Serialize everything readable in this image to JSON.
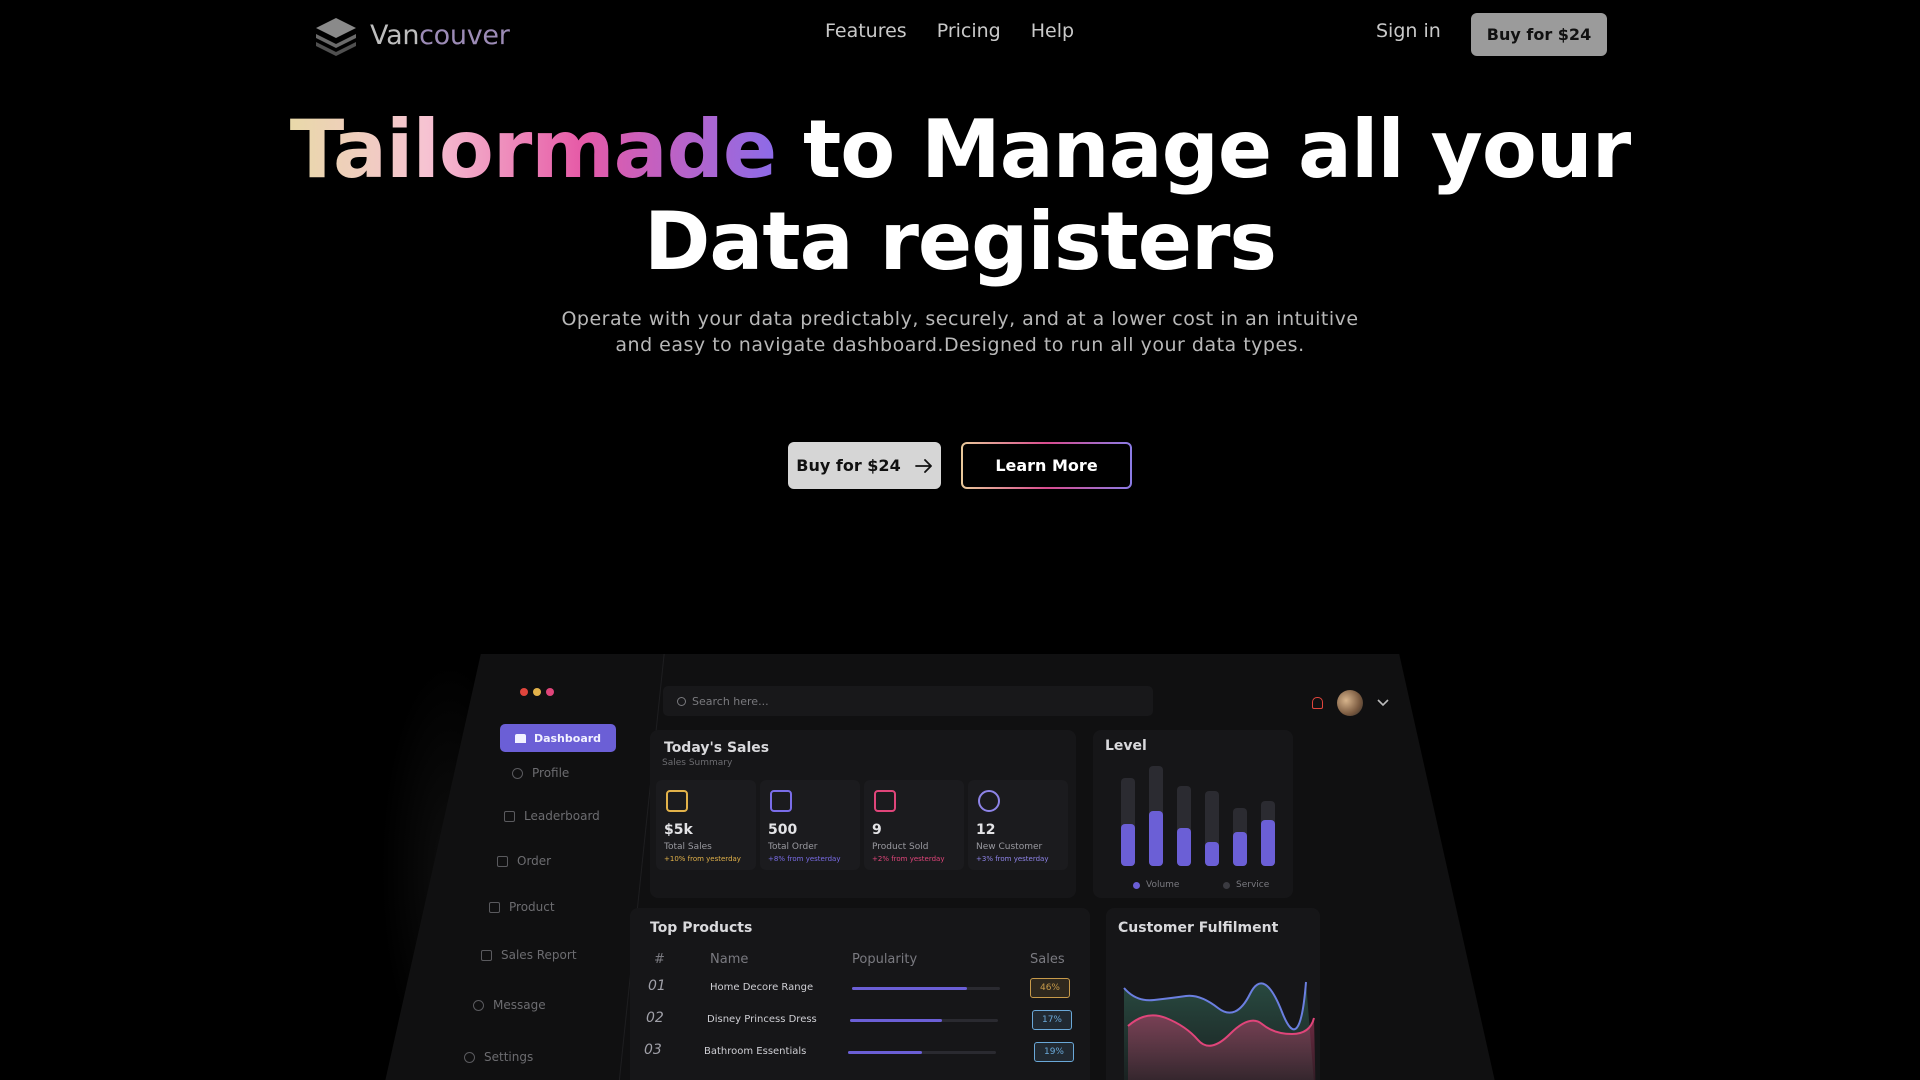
{
  "nav": {
    "logo_part1": "Van",
    "logo_part2": "couver",
    "links": [
      "Features",
      "Pricing",
      "Help"
    ],
    "signin": "Sign in",
    "buy": "Buy for $24"
  },
  "hero": {
    "title_highlight": "Tailormade",
    "title_rest_line1": " to Manage all your",
    "title_line2": "Data registers",
    "subtitle_line1": "Operate with your data predictably, securely, and at a lower cost in an intuitive",
    "subtitle_line2": "and easy to navigate dashboard.Designed to run all your data types.",
    "buy_label": "Buy for $24",
    "learn_label": "Learn More"
  },
  "dashboard": {
    "sidebar": [
      "Dashboard",
      "Profile",
      "Leaderboard",
      "Order",
      "Product",
      "Sales Report",
      "Message",
      "Settings"
    ],
    "search_placeholder": "Search here...",
    "sales": {
      "title": "Today's Sales",
      "subtitle": "Sales Summary",
      "stats": [
        {
          "value": "$5k",
          "label": "Total Sales",
          "change": "+10% from yesterday",
          "color": "#e2b24a"
        },
        {
          "value": "500",
          "label": "Total Order",
          "change": "+8% from yesterday",
          "color": "#7a6de8"
        },
        {
          "value": "9",
          "label": "Product Sold",
          "change": "+2% from yesterday",
          "color": "#e0457a"
        },
        {
          "value": "12",
          "label": "New Customer",
          "change": "+3% from yesterday",
          "color": "#8e84e8"
        }
      ]
    },
    "level": {
      "title": "Level",
      "legend": [
        "Volume",
        "Service"
      ],
      "volume_fractions": [
        0.42,
        0.55,
        0.38,
        0.24,
        0.34,
        0.46
      ],
      "service_fractions": [
        0.88,
        1.0,
        0.8,
        0.75,
        0.58,
        0.65
      ]
    },
    "products": {
      "title": "Top Products",
      "headers": [
        "#",
        "Name",
        "Popularity",
        "Sales"
      ],
      "rows": [
        {
          "n": "01",
          "name": "Home Decore Range",
          "pop": 0.78,
          "sales": "46%",
          "color": "#c79a4a"
        },
        {
          "n": "02",
          "name": "Disney Princess Dress",
          "pop": 0.62,
          "sales": "17%",
          "color": "#6aa8d8"
        },
        {
          "n": "03",
          "name": "Bathroom Essentials",
          "pop": 0.5,
          "sales": "19%",
          "color": "#6aa8d8"
        }
      ]
    },
    "fulfilment": {
      "title": "Customer Fulfilment"
    }
  },
  "colors": {
    "accent": "#6b5fd6",
    "dot_red": "#e0453c",
    "dot_yellow": "#e2b24a",
    "dot_pink": "#e0457a"
  }
}
